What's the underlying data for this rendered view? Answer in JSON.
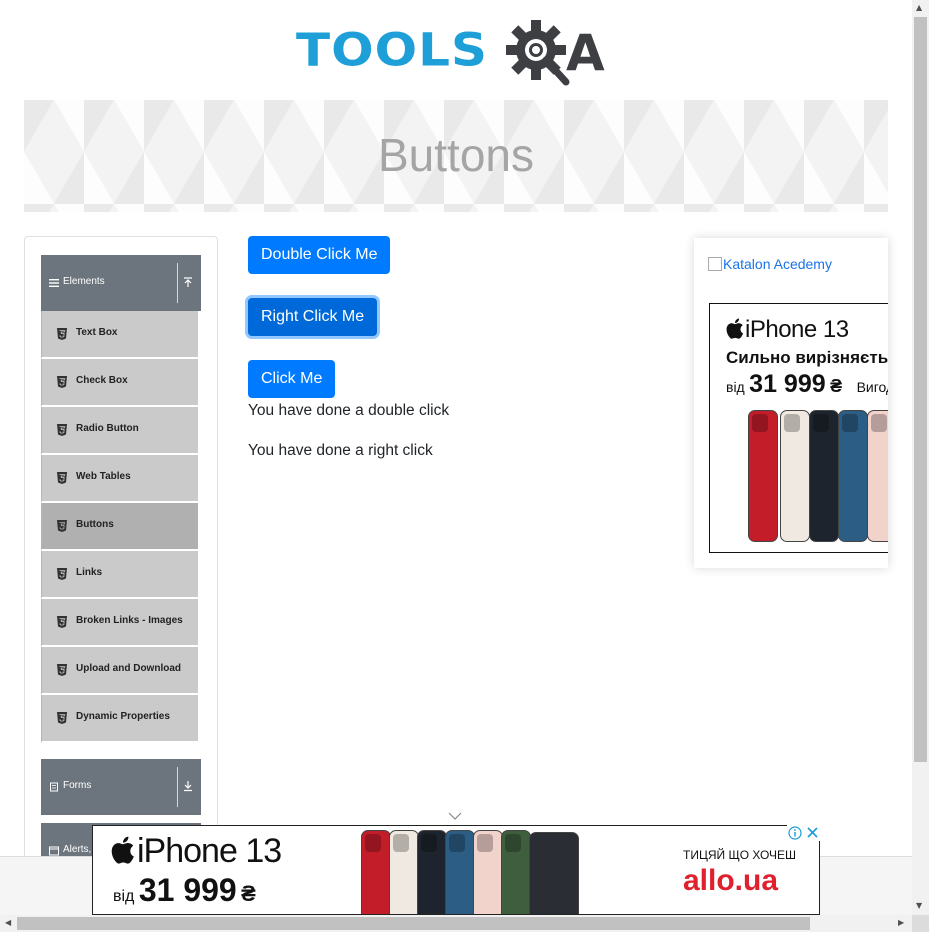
{
  "header": {
    "logo_text_left": "TOOLS",
    "logo_text_right": "A",
    "logo_alt": "TOOLSQA",
    "brand_blue": "#1e9fd8",
    "brand_dark": "#3d3f43"
  },
  "banner": {
    "title": "Buttons"
  },
  "sidebar": {
    "groups": [
      {
        "label": "Elements",
        "icon": "hamburger-icon",
        "toggle_icon": "arrow-up-icon",
        "expanded": true
      },
      {
        "label": "Forms",
        "icon": "list-icon",
        "toggle_icon": "arrow-down-icon",
        "expanded": false
      },
      {
        "label": "Alerts,",
        "icon": "window-icon",
        "toggle_icon": "arrow-down-icon",
        "expanded": false
      }
    ],
    "items": [
      {
        "label": "Text Box",
        "active": false
      },
      {
        "label": "Check Box",
        "active": false
      },
      {
        "label": "Radio Button",
        "active": false
      },
      {
        "label": "Web Tables",
        "active": false
      },
      {
        "label": "Buttons",
        "active": true
      },
      {
        "label": "Links",
        "active": false
      },
      {
        "label": "Broken Links - Images",
        "active": false
      },
      {
        "label": "Upload and Download",
        "active": false
      },
      {
        "label": "Dynamic Properties",
        "active": false
      }
    ],
    "item_icon": "html5-icon",
    "header_color": "#6c757d",
    "item_color": "#cacaca",
    "active_item_color": "#b0b0b0"
  },
  "main": {
    "double_click_button": "Double Click Me",
    "right_click_button": "Right Click Me",
    "click_button": "Click Me",
    "double_click_message": "You have done a double click",
    "right_click_message": "You have done a right click",
    "button_color": "#007bff"
  },
  "side_ad": {
    "broken_image_alt": "Katalon Acedemy",
    "title": "iPhone 13",
    "subtitle": "Сильно вирізняється",
    "price_from": "від",
    "price": "31 999",
    "currency": "₴",
    "extra": "Вигода"
  },
  "bottom_ad": {
    "title": "iPhone 13",
    "price_from": "від",
    "price": "31 999",
    "currency": "₴",
    "slogan": "ТИЦЯЙ ЩО ХОЧЕШ",
    "brand": "allo.ua",
    "brand_color": "#e0202d"
  }
}
